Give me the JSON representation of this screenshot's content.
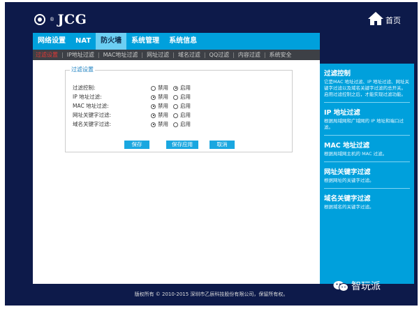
{
  "header": {
    "logo": "JCG",
    "home_label": "首页"
  },
  "nav": {
    "tabs": [
      "网络设置",
      "NAT",
      "防火墙",
      "系统管理",
      "系统信息"
    ],
    "active": 2
  },
  "subnav": {
    "items": [
      "过滤设置",
      "IP地址过滤",
      "MAC地址过滤",
      "网址过滤",
      "域名过滤",
      "QQ过滤",
      "内容过滤",
      "系统安全"
    ],
    "active": 0
  },
  "filter": {
    "legend": "过滤设置",
    "rows": [
      {
        "label": "过滤控制:",
        "selected": "启用"
      },
      {
        "label": "IP 地址过滤:",
        "selected": "禁用"
      },
      {
        "label": "MAC 地址过滤:",
        "selected": "禁用"
      },
      {
        "label": "网址关键字过滤:",
        "selected": "禁用"
      },
      {
        "label": "域名关键字过滤:",
        "selected": "禁用"
      }
    ],
    "option_disable": "禁用",
    "option_enable": "启用",
    "buttons": {
      "save": "保存",
      "save_apply": "保存应用",
      "cancel": "取消"
    }
  },
  "sidebar": [
    {
      "title": "过滤控制",
      "text": "它是MAC 地址过滤、IP 地址过滤、网址关键字过滤以及域名关键字过滤的总开关。启用过滤控制之后，才能实现过滤功能。"
    },
    {
      "title": "IP 地址过滤",
      "text": "根据局域网和广域网的 IP 地址和端口过滤。"
    },
    {
      "title": "MAC 地址过滤",
      "text": "根据局域网主机的 MAC 过滤。"
    },
    {
      "title": "网址关键字过滤",
      "text": "根据网址的关键字过滤。"
    },
    {
      "title": "域名关键字过滤",
      "text": "根据域名的关键字过滤。"
    }
  ],
  "footer": {
    "copyright": "版权所有 © 2010-2015 深圳市乙辰科技股份有限公司，保留所有权。"
  },
  "watermark": "智玩派",
  "colors": {
    "background": "#0d1a4a",
    "accent": "#00a0dc",
    "active_tab": "#6ccff3",
    "subnav_bg": "#3d4046",
    "subnav_active": "#e53935"
  }
}
